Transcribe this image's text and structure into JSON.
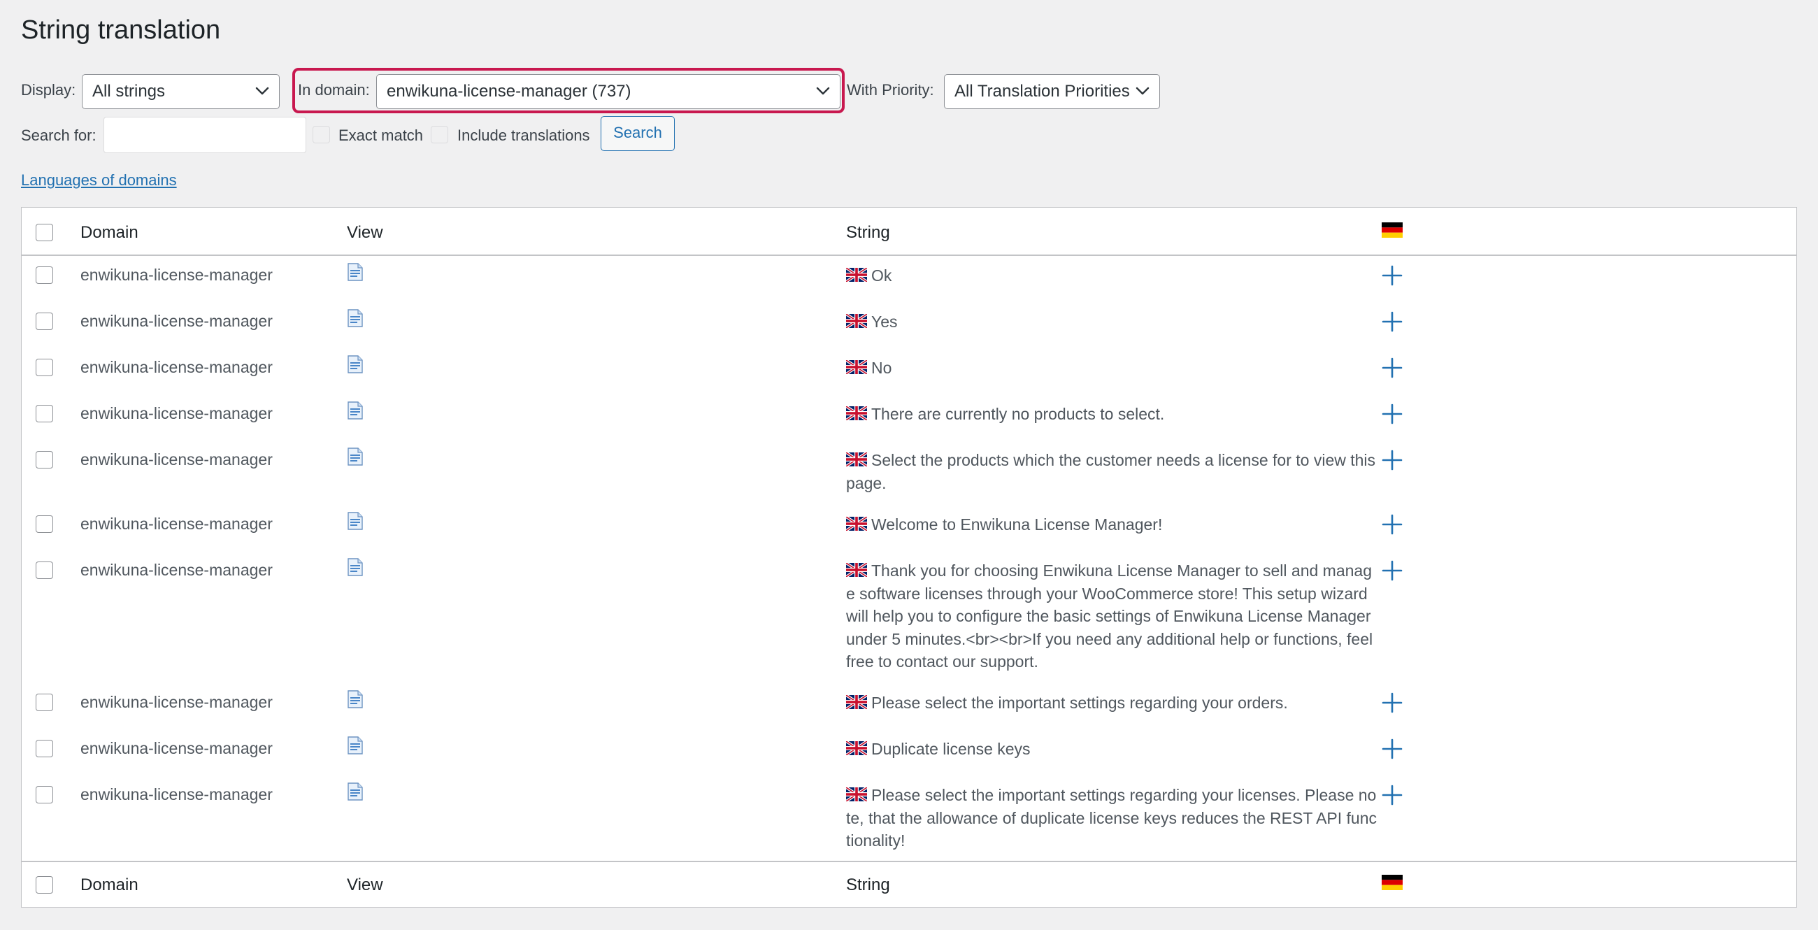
{
  "page": {
    "title": "String translation"
  },
  "filters": {
    "display_label": "Display:",
    "display_value": "All strings",
    "domain_label": "In domain:",
    "domain_value": "enwikuna-license-manager (737)",
    "priority_label": "With Priority:",
    "priority_value": "All Translation Priorities",
    "search_label": "Search for:",
    "search_value": "",
    "exact_match_label": "Exact match",
    "include_translations_label": "Include translations",
    "search_button": "Search"
  },
  "links": {
    "languages_of_domains": "Languages of domains"
  },
  "table": {
    "columns": {
      "domain": "Domain",
      "view": "View",
      "string": "String"
    },
    "target_language_flag": "germany-flag-icon",
    "source_language_flag": "uk-flag-icon",
    "rows": [
      {
        "domain": "enwikuna-license-manager",
        "string": "Ok"
      },
      {
        "domain": "enwikuna-license-manager",
        "string": "Yes"
      },
      {
        "domain": "enwikuna-license-manager",
        "string": "No"
      },
      {
        "domain": "enwikuna-license-manager",
        "string": "There are currently no products to select."
      },
      {
        "domain": "enwikuna-license-manager",
        "string": "Select the products which the customer needs a license for to view this page."
      },
      {
        "domain": "enwikuna-license-manager",
        "string": "Welcome to Enwikuna License Manager!"
      },
      {
        "domain": "enwikuna-license-manager",
        "string": "Thank you for choosing Enwikuna License Manager to sell and manage software licenses through your WooCommerce store! This setup wizard will help you to configure the basic settings of Enwikuna License Manager under 5 minutes.<br><br>If you need any additional help or functions, feel free to contact our support."
      },
      {
        "domain": "enwikuna-license-manager",
        "string": "Please select the important settings regarding your orders."
      },
      {
        "domain": "enwikuna-license-manager",
        "string": "Duplicate license keys"
      },
      {
        "domain": "enwikuna-license-manager",
        "string": "Please select the important settings regarding your licenses. Please note, that the allowance of duplicate license keys reduces the REST API functionality!"
      }
    ]
  },
  "colors": {
    "accent": "#2271b1",
    "highlight": "#c8184f"
  }
}
